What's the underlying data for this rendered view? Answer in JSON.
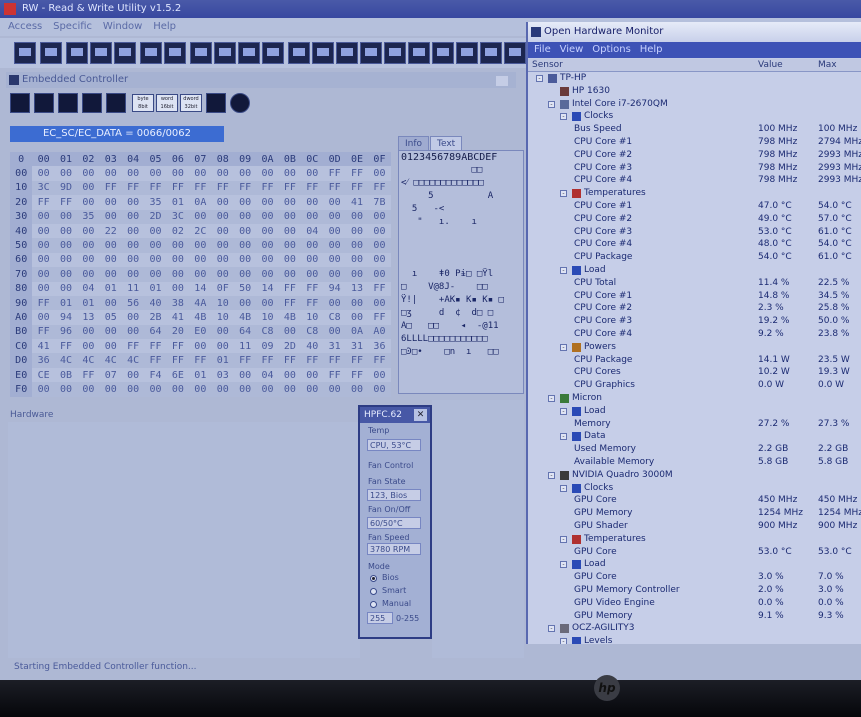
{
  "rw": {
    "title": "RW - Read & Write Utility v1.5.2",
    "menu": [
      "Access",
      "Specific",
      "Window",
      "Help"
    ]
  },
  "ec": {
    "title": "Embedded Controller",
    "field": "EC_SC/EC_DATA = 0066/0062",
    "toolbar_texts": [
      "byte 8bit",
      "word 16bit",
      "dword 32bit"
    ],
    "col_headers": [
      "0",
      "00",
      "01",
      "02",
      "03",
      "04",
      "05",
      "06",
      "07",
      "08",
      "09",
      "0A",
      "0B",
      "0C",
      "0D",
      "0E",
      "0F"
    ],
    "rows": [
      {
        "h": "00",
        "c": [
          "00",
          "00",
          "00",
          "00",
          "00",
          "00",
          "00",
          "00",
          "00",
          "00",
          "00",
          "00",
          "00",
          "FF",
          "FF",
          "00"
        ]
      },
      {
        "h": "10",
        "c": [
          "3C",
          "9D",
          "00",
          "FF",
          "FF",
          "FF",
          "FF",
          "FF",
          "FF",
          "FF",
          "FF",
          "FF",
          "FF",
          "FF",
          "FF",
          "FF"
        ]
      },
      {
        "h": "20",
        "c": [
          "FF",
          "FF",
          "00",
          "00",
          "00",
          "35",
          "01",
          "0A",
          "00",
          "00",
          "00",
          "00",
          "00",
          "00",
          "41",
          "7B"
        ]
      },
      {
        "h": "30",
        "c": [
          "00",
          "00",
          "35",
          "00",
          "00",
          "2D",
          "3C",
          "00",
          "00",
          "00",
          "00",
          "00",
          "00",
          "00",
          "00",
          "00"
        ]
      },
      {
        "h": "40",
        "c": [
          "00",
          "00",
          "00",
          "22",
          "00",
          "00",
          "02",
          "2C",
          "00",
          "00",
          "00",
          "00",
          "04",
          "00",
          "00",
          "00"
        ]
      },
      {
        "h": "50",
        "c": [
          "00",
          "00",
          "00",
          "00",
          "00",
          "00",
          "00",
          "00",
          "00",
          "00",
          "00",
          "00",
          "00",
          "00",
          "00",
          "00"
        ]
      },
      {
        "h": "60",
        "c": [
          "00",
          "00",
          "00",
          "00",
          "00",
          "00",
          "00",
          "00",
          "00",
          "00",
          "00",
          "00",
          "00",
          "00",
          "00",
          "00"
        ]
      },
      {
        "h": "70",
        "c": [
          "00",
          "00",
          "00",
          "00",
          "00",
          "00",
          "00",
          "00",
          "00",
          "00",
          "00",
          "00",
          "00",
          "00",
          "00",
          "00"
        ]
      },
      {
        "h": "80",
        "c": [
          "00",
          "00",
          "04",
          "01",
          "11",
          "01",
          "00",
          "14",
          "0F",
          "50",
          "14",
          "FF",
          "FF",
          "94",
          "13",
          "FF"
        ]
      },
      {
        "h": "90",
        "c": [
          "FF",
          "01",
          "01",
          "00",
          "56",
          "40",
          "38",
          "4A",
          "10",
          "00",
          "00",
          "FF",
          "FF",
          "00",
          "00",
          "00"
        ]
      },
      {
        "h": "A0",
        "c": [
          "00",
          "94",
          "13",
          "05",
          "00",
          "2B",
          "41",
          "4B",
          "10",
          "4B",
          "10",
          "4B",
          "10",
          "C8",
          "00",
          "FF"
        ]
      },
      {
        "h": "B0",
        "c": [
          "FF",
          "96",
          "00",
          "00",
          "00",
          "64",
          "20",
          "E0",
          "00",
          "64",
          "C8",
          "00",
          "C8",
          "00",
          "0A",
          "A0"
        ]
      },
      {
        "h": "C0",
        "c": [
          "41",
          "FF",
          "00",
          "00",
          "FF",
          "FF",
          "FF",
          "00",
          "00",
          "11",
          "09",
          "2D",
          "40",
          "31",
          "31",
          "36"
        ]
      },
      {
        "h": "D0",
        "c": [
          "36",
          "4C",
          "4C",
          "4C",
          "4C",
          "FF",
          "FF",
          "FF",
          "01",
          "FF",
          "FF",
          "FF",
          "FF",
          "FF",
          "FF",
          "FF"
        ]
      },
      {
        "h": "E0",
        "c": [
          "CE",
          "0B",
          "FF",
          "07",
          "00",
          "F4",
          "6E",
          "01",
          "03",
          "00",
          "04",
          "00",
          "00",
          "FF",
          "FF",
          "00"
        ]
      },
      {
        "h": "F0",
        "c": [
          "00",
          "00",
          "00",
          "00",
          "00",
          "00",
          "00",
          "00",
          "00",
          "00",
          "00",
          "00",
          "00",
          "00",
          "00",
          "00"
        ]
      }
    ],
    "text_tabs": [
      "Info",
      "Text"
    ],
    "text_header": "0123456789ABCDEF",
    "text_lines": [
      "             □□",
      "<⁄ □□□□□□□□□□□□□",
      "     5          A",
      "  5   -<",
      "   \"   ı.    ı",
      "",
      "",
      "",
      "  ı    ǂ0 Pɨ□ □Ϋl",
      "□    V@8J-    □□",
      "Ϋ!|    +AK▪ K▪ K▪ □",
      "□ʒ     d  ¢  d□ □",
      "A□   □□    ◂  -@11",
      "6LLLL□□□□□□□□□□□",
      "□Ͽ□•    □n  ı   □□"
    ],
    "hardware_label": "Hardware",
    "status": "Starting Embedded Controller function..."
  },
  "hpfc": {
    "title": "HPFC.62",
    "temp_label": "Temp",
    "temp_value": "CPU, 53°C",
    "fan_control_label": "Fan Control",
    "fan_state_label": "Fan State",
    "fan_state_value": "123, Bios",
    "fan_onoff_label": "Fan On/Off",
    "fan_onoff_value": "60/50°C",
    "fan_speed_label": "Fan Speed",
    "fan_speed_value": "3780 RPM",
    "mode_label": "Mode",
    "modes": [
      "Bios",
      "Smart",
      "Manual"
    ],
    "selected_mode": "Bios",
    "manual_value": "255",
    "manual_range": "0-255"
  },
  "ohm": {
    "title": "Open Hardware Monitor",
    "menu": [
      "File",
      "View",
      "Options",
      "Help"
    ],
    "columns": {
      "sensor": "Sensor",
      "value": "Value",
      "max": "Max"
    },
    "rows": [
      {
        "lvl": 0,
        "ex": "-",
        "icon": "computer",
        "name": "TP-HP",
        "value": "",
        "max": ""
      },
      {
        "lvl": 1,
        "ex": "",
        "icon": "board",
        "name": "HP 1630",
        "value": "",
        "max": ""
      },
      {
        "lvl": 1,
        "ex": "-",
        "icon": "cpu",
        "name": "Intel Core i7-2670QM",
        "value": "",
        "max": ""
      },
      {
        "lvl": 2,
        "ex": "-",
        "icon": "clock",
        "name": "Clocks",
        "value": "",
        "max": ""
      },
      {
        "lvl": 3,
        "ex": "",
        "icon": "",
        "name": "Bus Speed",
        "value": "100 MHz",
        "max": "100 MHz"
      },
      {
        "lvl": 3,
        "ex": "",
        "icon": "",
        "name": "CPU Core #1",
        "value": "798 MHz",
        "max": "2794 MHz"
      },
      {
        "lvl": 3,
        "ex": "",
        "icon": "",
        "name": "CPU Core #2",
        "value": "798 MHz",
        "max": "2993 MHz"
      },
      {
        "lvl": 3,
        "ex": "",
        "icon": "",
        "name": "CPU Core #3",
        "value": "798 MHz",
        "max": "2993 MHz"
      },
      {
        "lvl": 3,
        "ex": "",
        "icon": "",
        "name": "CPU Core #4",
        "value": "798 MHz",
        "max": "2993 MHz"
      },
      {
        "lvl": 2,
        "ex": "-",
        "icon": "thermo",
        "name": "Temperatures",
        "value": "",
        "max": ""
      },
      {
        "lvl": 3,
        "ex": "",
        "icon": "",
        "name": "CPU Core #1",
        "value": "47.0 °C",
        "max": "54.0 °C"
      },
      {
        "lvl": 3,
        "ex": "",
        "icon": "",
        "name": "CPU Core #2",
        "value": "49.0 °C",
        "max": "57.0 °C"
      },
      {
        "lvl": 3,
        "ex": "",
        "icon": "",
        "name": "CPU Core #3",
        "value": "53.0 °C",
        "max": "61.0 °C"
      },
      {
        "lvl": 3,
        "ex": "",
        "icon": "",
        "name": "CPU Core #4",
        "value": "48.0 °C",
        "max": "54.0 °C"
      },
      {
        "lvl": 3,
        "ex": "",
        "icon": "",
        "name": "CPU Package",
        "value": "54.0 °C",
        "max": "61.0 °C"
      },
      {
        "lvl": 2,
        "ex": "-",
        "icon": "load",
        "name": "Load",
        "value": "",
        "max": ""
      },
      {
        "lvl": 3,
        "ex": "",
        "icon": "",
        "name": "CPU Total",
        "value": "11.4 %",
        "max": "22.5 %"
      },
      {
        "lvl": 3,
        "ex": "",
        "icon": "",
        "name": "CPU Core #1",
        "value": "14.8 %",
        "max": "34.5 %"
      },
      {
        "lvl": 3,
        "ex": "",
        "icon": "",
        "name": "CPU Core #2",
        "value": "2.3 %",
        "max": "25.8 %"
      },
      {
        "lvl": 3,
        "ex": "",
        "icon": "",
        "name": "CPU Core #3",
        "value": "19.2 %",
        "max": "50.0 %"
      },
      {
        "lvl": 3,
        "ex": "",
        "icon": "",
        "name": "CPU Core #4",
        "value": "9.2 %",
        "max": "23.8 %"
      },
      {
        "lvl": 2,
        "ex": "-",
        "icon": "power",
        "name": "Powers",
        "value": "",
        "max": ""
      },
      {
        "lvl": 3,
        "ex": "",
        "icon": "",
        "name": "CPU Package",
        "value": "14.1 W",
        "max": "23.5 W"
      },
      {
        "lvl": 3,
        "ex": "",
        "icon": "",
        "name": "CPU Cores",
        "value": "10.2 W",
        "max": "19.3 W"
      },
      {
        "lvl": 3,
        "ex": "",
        "icon": "",
        "name": "CPU Graphics",
        "value": "0.0 W",
        "max": "0.0 W"
      },
      {
        "lvl": 1,
        "ex": "-",
        "icon": "ram",
        "name": "Micron",
        "value": "",
        "max": ""
      },
      {
        "lvl": 2,
        "ex": "-",
        "icon": "load",
        "name": "Load",
        "value": "",
        "max": ""
      },
      {
        "lvl": 3,
        "ex": "",
        "icon": "",
        "name": "Memory",
        "value": "27.2 %",
        "max": "27.3 %"
      },
      {
        "lvl": 2,
        "ex": "-",
        "icon": "load",
        "name": "Data",
        "value": "",
        "max": ""
      },
      {
        "lvl": 3,
        "ex": "",
        "icon": "",
        "name": "Used Memory",
        "value": "2.2 GB",
        "max": "2.2 GB"
      },
      {
        "lvl": 3,
        "ex": "",
        "icon": "",
        "name": "Available Memory",
        "value": "5.8 GB",
        "max": "5.8 GB"
      },
      {
        "lvl": 1,
        "ex": "-",
        "icon": "gpu",
        "name": "NVIDIA Quadro 3000M",
        "value": "",
        "max": ""
      },
      {
        "lvl": 2,
        "ex": "-",
        "icon": "clock",
        "name": "Clocks",
        "value": "",
        "max": ""
      },
      {
        "lvl": 3,
        "ex": "",
        "icon": "",
        "name": "GPU Core",
        "value": "450 MHz",
        "max": "450 MHz"
      },
      {
        "lvl": 3,
        "ex": "",
        "icon": "",
        "name": "GPU Memory",
        "value": "1254 MHz",
        "max": "1254 MHz"
      },
      {
        "lvl": 3,
        "ex": "",
        "icon": "",
        "name": "GPU Shader",
        "value": "900 MHz",
        "max": "900 MHz"
      },
      {
        "lvl": 2,
        "ex": "-",
        "icon": "thermo",
        "name": "Temperatures",
        "value": "",
        "max": ""
      },
      {
        "lvl": 3,
        "ex": "",
        "icon": "",
        "name": "GPU Core",
        "value": "53.0 °C",
        "max": "53.0 °C"
      },
      {
        "lvl": 2,
        "ex": "-",
        "icon": "load",
        "name": "Load",
        "value": "",
        "max": ""
      },
      {
        "lvl": 3,
        "ex": "",
        "icon": "",
        "name": "GPU Core",
        "value": "3.0 %",
        "max": "7.0 %"
      },
      {
        "lvl": 3,
        "ex": "",
        "icon": "",
        "name": "GPU Memory Controller",
        "value": "2.0 %",
        "max": "3.0 %"
      },
      {
        "lvl": 3,
        "ex": "",
        "icon": "",
        "name": "GPU Video Engine",
        "value": "0.0 %",
        "max": "0.0 %"
      },
      {
        "lvl": 3,
        "ex": "",
        "icon": "",
        "name": "GPU Memory",
        "value": "9.1 %",
        "max": "9.3 %"
      },
      {
        "lvl": 1,
        "ex": "-",
        "icon": "disk",
        "name": "OCZ-AGILITY3",
        "value": "",
        "max": ""
      },
      {
        "lvl": 2,
        "ex": "-",
        "icon": "load",
        "name": "Levels",
        "value": "",
        "max": ""
      }
    ]
  },
  "bezel": {
    "logo": "hp"
  }
}
